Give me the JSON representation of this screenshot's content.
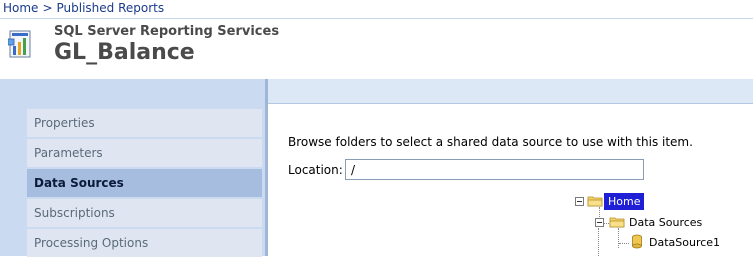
{
  "breadcrumb": {
    "home": "Home",
    "separator": ">",
    "current": "Published Reports"
  },
  "header": {
    "app_name": "SQL Server Reporting Services",
    "report_title": "GL_Balance",
    "icon": "report-icon"
  },
  "nav": {
    "items": [
      {
        "label": "Properties",
        "active": false
      },
      {
        "label": "Parameters",
        "active": false
      },
      {
        "label": "Data Sources",
        "active": true
      },
      {
        "label": "Subscriptions",
        "active": false
      },
      {
        "label": "Processing Options",
        "active": false
      }
    ]
  },
  "content": {
    "instructions": "Browse folders to select a shared data source to use with this item.",
    "location_label": "Location:",
    "location_value": "/"
  },
  "tree": {
    "root": "Home",
    "folder": "Data Sources",
    "item": "DataSource1",
    "icons": [
      "folder-icon",
      "datasource-icon",
      "expand-collapse-icon"
    ]
  },
  "colors": {
    "link": "#1a3a8c",
    "sidebar_bg": "#c9daf1",
    "nav_item_bg": "#dfe6f1",
    "nav_active_bg": "#a7bde0",
    "tree_selected_bg": "#1f1fd6"
  }
}
